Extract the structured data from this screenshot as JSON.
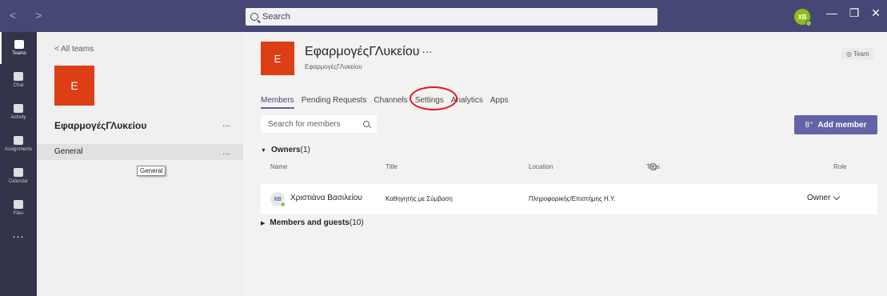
{
  "titlebar": {
    "search_placeholder": "Search",
    "avatar_initials": "XB",
    "nav_arrows": "< >",
    "minimize": "—",
    "maximize": "❐",
    "close": "✕"
  },
  "rail": {
    "items": [
      {
        "label": "Teams",
        "icon": "teams-icon",
        "active": true
      },
      {
        "label": "Chat",
        "icon": "chat-icon"
      },
      {
        "label": "Activity",
        "icon": "bell-icon"
      },
      {
        "label": "Assignments",
        "icon": "assignments-icon"
      },
      {
        "label": "Calendar",
        "icon": "calendar-icon"
      },
      {
        "label": "Files",
        "icon": "files-icon"
      }
    ],
    "more": "..."
  },
  "team_panel": {
    "back_label": "<  All teams",
    "tile_letter": "E",
    "team_name": "ΕφαρμογέςΓΛυκείου",
    "more": "...",
    "channel": "General",
    "channel_more": "...",
    "tooltip": "General"
  },
  "main": {
    "tile_letter": "E",
    "title": "ΕφαρμογέςΓΛυκείου",
    "title_dots": "···",
    "subtitle": "ΕφαρμογέςΓΛυκείου",
    "team_badge": "◎ Team",
    "tabs": [
      "Members",
      "Pending Requests",
      "Channels",
      "Settings",
      "Analytics",
      "Apps"
    ],
    "search_placeholder": "Search for members",
    "add_member_label": "Add member",
    "add_member_icon": "8⁺",
    "owners_label": "Owners",
    "owners_count": "(1)",
    "columns": {
      "name": "Name",
      "title": "Title",
      "location": "Location",
      "tags": "Tags",
      "role": "Role"
    },
    "member": {
      "initials": "XB",
      "name": "Χριστιάνα Βασιλείου",
      "title": "Καθηγητής με Σύμβαση",
      "location": "Πληροφορικής/Επιστήμης Η.Υ.",
      "role": "Owner"
    },
    "guests_label": "Members and guests",
    "guests_count": "(10)"
  },
  "colors": {
    "titlebar": "#464775",
    "rail": "#33344a",
    "accent": "#6264a7",
    "tile": "#dc3e15",
    "highlight": "#e81123"
  }
}
